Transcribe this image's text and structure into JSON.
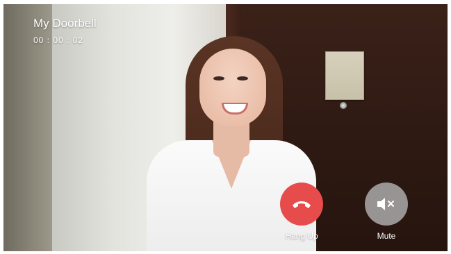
{
  "call": {
    "title": "My Doorbell",
    "timer": "00 : 00 : 02"
  },
  "controls": {
    "hang_up": {
      "label": "Hang Up",
      "icon": "phone-hangup-icon",
      "color": "#e74c4c"
    },
    "mute": {
      "label": "Mute",
      "icon": "speaker-mute-icon",
      "color": "#aaaaaa"
    }
  }
}
